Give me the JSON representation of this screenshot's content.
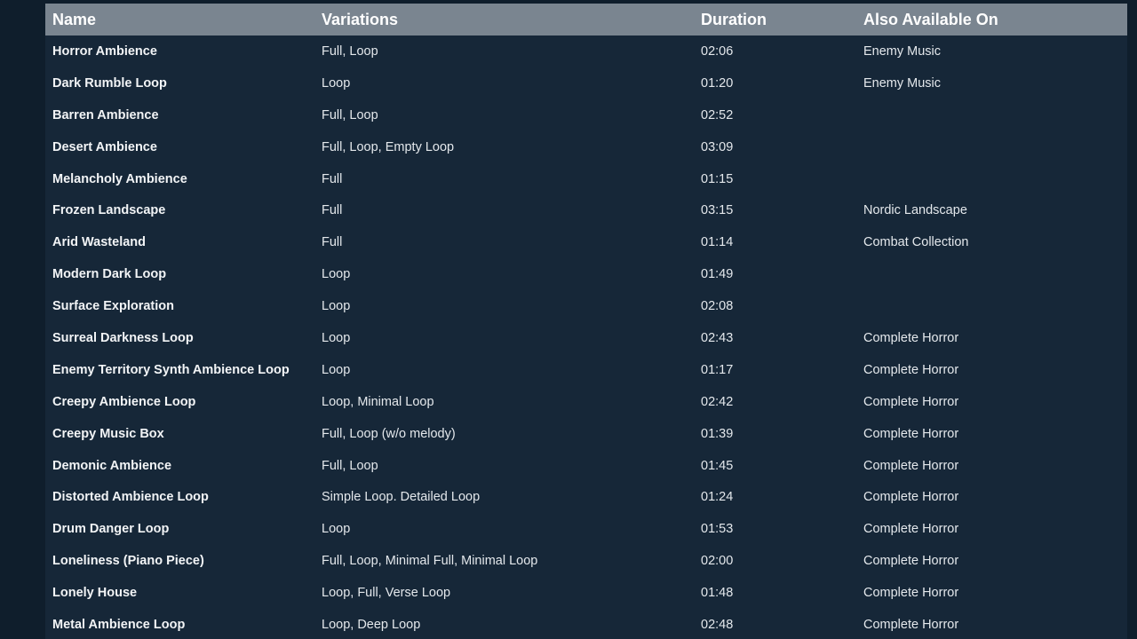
{
  "table": {
    "headers": {
      "name": "Name",
      "variations": "Variations",
      "duration": "Duration",
      "also_available_on": "Also Available On"
    },
    "rows": [
      {
        "name": "Horror Ambience",
        "variations": "Full, Loop",
        "duration": "02:06",
        "also": "Enemy Music"
      },
      {
        "name": "Dark Rumble Loop",
        "variations": "Loop",
        "duration": "01:20",
        "also": "Enemy Music"
      },
      {
        "name": "Barren Ambience",
        "variations": "Full, Loop",
        "duration": "02:52",
        "also": ""
      },
      {
        "name": "Desert Ambience",
        "variations": "Full, Loop, Empty Loop",
        "duration": "03:09",
        "also": ""
      },
      {
        "name": "Melancholy Ambience",
        "variations": "Full",
        "duration": "01:15",
        "also": ""
      },
      {
        "name": "Frozen Landscape",
        "variations": "Full",
        "duration": "03:15",
        "also": "Nordic Landscape"
      },
      {
        "name": "Arid Wasteland",
        "variations": "Full",
        "duration": "01:14",
        "also": "Combat Collection"
      },
      {
        "name": "Modern Dark Loop",
        "variations": "Loop",
        "duration": "01:49",
        "also": ""
      },
      {
        "name": "Surface Exploration",
        "variations": "Loop",
        "duration": "02:08",
        "also": ""
      },
      {
        "name": "Surreal Darkness Loop",
        "variations": "Loop",
        "duration": "02:43",
        "also": "Complete Horror"
      },
      {
        "name": "Enemy Territory Synth Ambience Loop",
        "variations": "Loop",
        "duration": "01:17",
        "also": "Complete Horror"
      },
      {
        "name": "Creepy Ambience Loop",
        "variations": "Loop, Minimal Loop",
        "duration": "02:42",
        "also": "Complete Horror"
      },
      {
        "name": "Creepy Music Box",
        "variations": "Full, Loop (w/o melody)",
        "duration": "01:39",
        "also": "Complete Horror"
      },
      {
        "name": "Demonic Ambience",
        "variations": "Full, Loop",
        "duration": "01:45",
        "also": "Complete Horror"
      },
      {
        "name": "Distorted Ambience Loop",
        "variations": "Simple Loop. Detailed Loop",
        "duration": "01:24",
        "also": "Complete Horror"
      },
      {
        "name": "Drum Danger Loop",
        "variations": "Loop",
        "duration": "01:53",
        "also": "Complete Horror"
      },
      {
        "name": "Loneliness (Piano Piece)",
        "variations": "Full, Loop, Minimal Full, Minimal Loop",
        "duration": "02:00",
        "also": "Complete Horror"
      },
      {
        "name": "Lonely House",
        "variations": "Loop, Full, Verse Loop",
        "duration": "01:48",
        "also": "Complete Horror"
      },
      {
        "name": "Metal Ambience Loop",
        "variations": "Loop, Deep Loop",
        "duration": "02:48",
        "also": "Complete Horror"
      }
    ]
  }
}
